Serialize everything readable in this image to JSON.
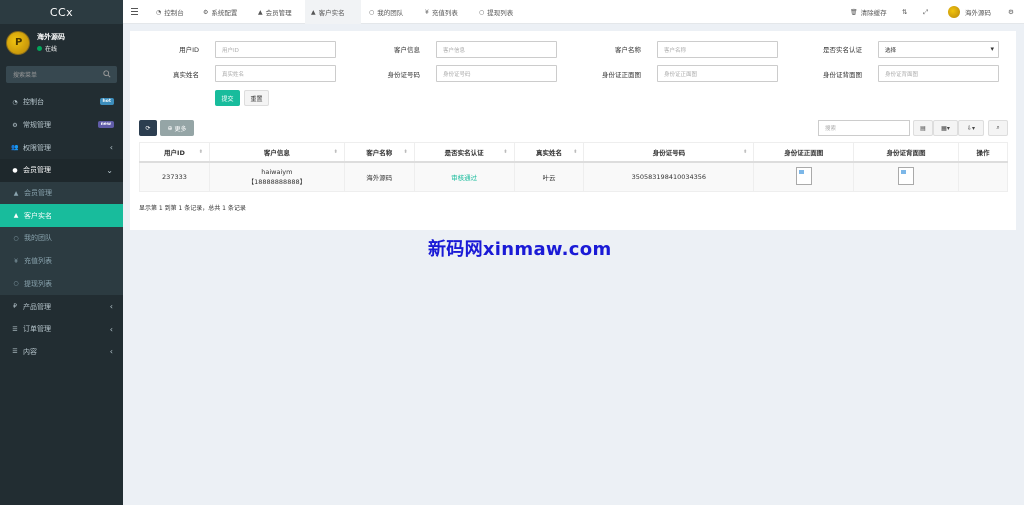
{
  "app": {
    "logo": "CCx"
  },
  "user": {
    "name": "海外源码",
    "status": "在线"
  },
  "sidebar": {
    "search_placeholder": "搜索菜单",
    "items": [
      {
        "label": "控制台",
        "icon": "dashboard-icon",
        "badge": "hot",
        "badge_color": "#3c8dbc"
      },
      {
        "label": "常规管理",
        "icon": "cogs-icon",
        "badge": "new",
        "badge_color": "#605ca8"
      },
      {
        "label": "权限管理",
        "icon": "group-icon"
      },
      {
        "label": "会员管理",
        "icon": "user-circle-icon"
      },
      {
        "label": "会员管理",
        "icon": "user-icon"
      },
      {
        "label": "客户实名",
        "icon": "user-icon"
      },
      {
        "label": "我的团队",
        "icon": "circle-icon"
      },
      {
        "label": "充值列表",
        "icon": "yen-icon"
      },
      {
        "label": "提现列表",
        "icon": "circle-icon"
      },
      {
        "label": "产品管理",
        "icon": "rmb-icon"
      },
      {
        "label": "订单管理",
        "icon": "list-icon"
      },
      {
        "label": "内容",
        "icon": "list-icon"
      }
    ]
  },
  "topnav": {
    "tabs": [
      {
        "label": "控制台"
      },
      {
        "label": "系统配置"
      },
      {
        "label": "会员管理"
      },
      {
        "label": "客户实名"
      },
      {
        "label": "我的团队"
      },
      {
        "label": "充值列表"
      },
      {
        "label": "提现列表"
      }
    ],
    "clear_cache": "清除缓存",
    "user_name": "海外源码"
  },
  "form": {
    "fields": [
      {
        "label": "用户ID",
        "placeholder": "用户ID"
      },
      {
        "label": "客户信息",
        "placeholder": "客户信息"
      },
      {
        "label": "客户名称",
        "placeholder": "客户名称"
      },
      {
        "label": "是否实名认证",
        "value": "选择"
      },
      {
        "label": "真实姓名",
        "placeholder": "真实姓名"
      },
      {
        "label": "身份证号码",
        "placeholder": "身份证号码"
      },
      {
        "label": "身份证正面图",
        "placeholder": "身份证正面图"
      },
      {
        "label": "身份证背面图",
        "placeholder": "身份证背面图"
      }
    ],
    "submit": "提交",
    "reset": "重置"
  },
  "toolbar": {
    "more": "更多",
    "search_placeholder": "搜索"
  },
  "table": {
    "headers": [
      "用户ID",
      "客户信息",
      "客户名称",
      "是否实名认证",
      "真实姓名",
      "身份证号码",
      "身份证正面图",
      "身份证背面图",
      "操作"
    ],
    "row": {
      "id": "237333",
      "info_line1": "haiwaiym",
      "info_line2": "【18888888888】",
      "name": "海外源码",
      "verified": "审核通过",
      "real_name": "叶云",
      "id_number": "350583198410034356"
    },
    "summary": "显示第 1 到第 1 条记录，总共 1 条记录"
  },
  "watermark": "新码网xinmaw.com"
}
